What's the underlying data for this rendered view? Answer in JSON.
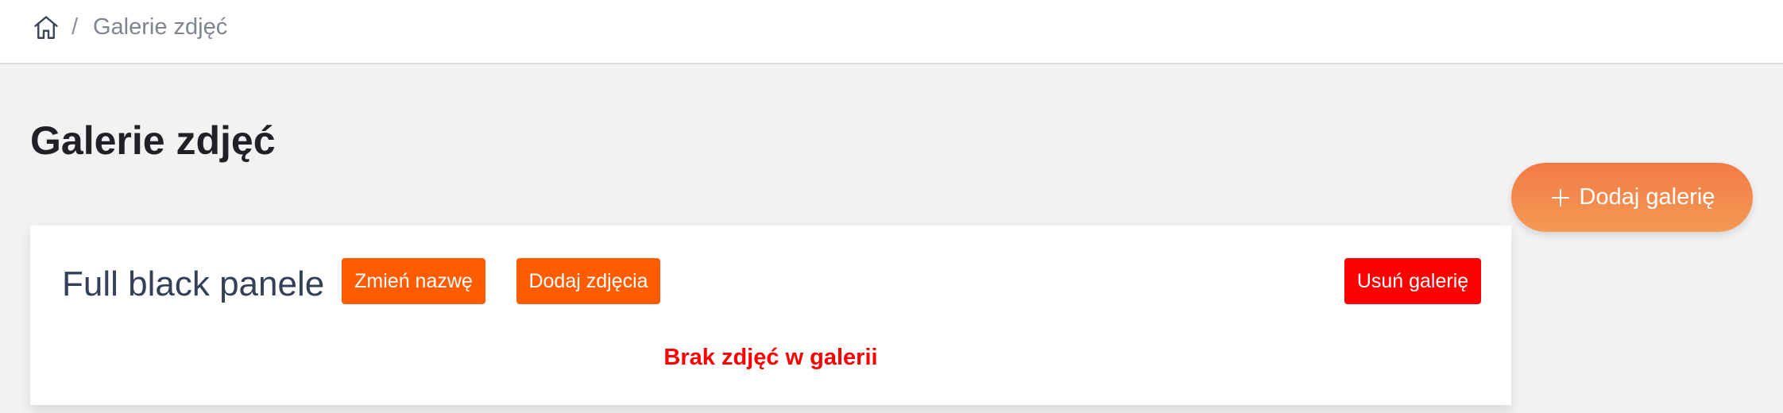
{
  "breadcrumb": {
    "home_icon": "home-icon",
    "separator": "/",
    "current": "Galerie zdjęć"
  },
  "page": {
    "title": "Galerie zdjęć"
  },
  "actions": {
    "add_gallery_label": "Dodaj galerię",
    "add_gallery_icon": "plus-icon"
  },
  "gallery": {
    "name": "Full black panele",
    "rename_label": "Zmień nazwę",
    "add_photos_label": "Dodaj zdjęcia",
    "delete_label": "Usuń galerię",
    "empty_message": "Brak zdjęć w galerii"
  },
  "colors": {
    "accent_orange": "#ff5c00",
    "danger_red": "#ff0000",
    "add_gallery_gradient_start": "#f37a45",
    "add_gallery_gradient_end": "#f39a55",
    "background": "#f2f2f2"
  }
}
